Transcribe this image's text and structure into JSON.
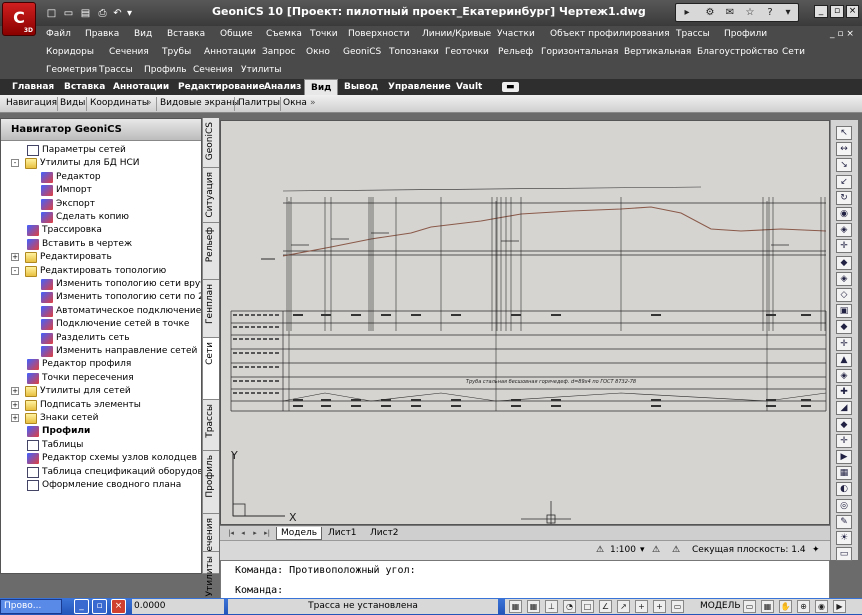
{
  "app": {
    "title": "GeoniCS 10 [Проект: пилотный проект_Екатеринбург]   Чертеж1.dwg",
    "logo_text": "3D"
  },
  "menu_row1": [
    "Файл",
    "Правка",
    "Вид",
    "Вставка",
    "Общие",
    "Съемка",
    "Точки",
    "Поверхности",
    "Линии/Кривые",
    "Участки",
    "Объект профилирования",
    "Трассы",
    "Профили"
  ],
  "menu_row2": [
    "Коридоры",
    "Сечения",
    "Трубы",
    "Аннотации",
    "Запрос",
    "Окно",
    "GeoniCS",
    "Топознаки",
    "Геоточки",
    "Рельеф",
    "Горизонтальная",
    "Вертикальная",
    "Благоустройство",
    "Сети"
  ],
  "menu_row3": [
    "Геометрия",
    "Трассы",
    "Профиль",
    "Сечения",
    "Утилиты"
  ],
  "ribbon_tabs": [
    "Главная",
    "Вставка",
    "Аннотации",
    "Редактирование",
    "Анализ",
    "Вид",
    "Вывод",
    "Управление",
    "Vault"
  ],
  "ribbon_active": "Вид",
  "ribbon_panels": [
    "Навигация",
    "Виды",
    "Координаты",
    "Видовые экраны",
    "Палитры",
    "Окна"
  ],
  "navigator": {
    "title": "Навигатор GeoniCS",
    "items": [
      "Параметры сетей",
      "Утилиты для БД НСИ",
      "Редактор",
      "Импорт",
      "Экспорт",
      "Сделать копию",
      "Трассировка",
      "Вставить в чертеж",
      "Редактировать",
      "Редактировать топологию",
      "Изменить топологию сети вручную",
      "Изменить топологию сети по 2 точкам",
      "Автоматическое подключение сетей",
      "Подключение сетей в точке",
      "Разделить сеть",
      "Изменить направление сетей",
      "Редактор профиля",
      "Точки пересечения",
      "Утилиты для сетей",
      "Подписать элементы",
      "Знаки сетей",
      "Профили",
      "Таблицы",
      "Редактор схемы узлов колодцев",
      "Таблица спецификаций оборудования",
      "Оформление сводного плана"
    ]
  },
  "side_tabs": [
    "GeoniCS",
    "Ситуация",
    "Рельеф",
    "Генплан",
    "Сети",
    "Трассы",
    "Профиль",
    "Сечения",
    "Утилиты"
  ],
  "drawing": {
    "axis_y": "Y",
    "axis_x": "X",
    "table_note": "Труба стальная бесшовная горячедеф. d=89x4 по ГОСТ 8732-78"
  },
  "layout_tabs": [
    "Модель",
    "Лист1",
    "Лист2"
  ],
  "status": {
    "scale": "1:100",
    "section_plane": "Секущая плоскость: 1.4"
  },
  "command_lines": [
    "Команда:  Противоположный угол:",
    "Команда:"
  ],
  "taskbar": {
    "app_label": "Прово...",
    "coords": "0.0000",
    "trace": "Трасса не установлена",
    "model": "МОДЕЛЬ"
  }
}
